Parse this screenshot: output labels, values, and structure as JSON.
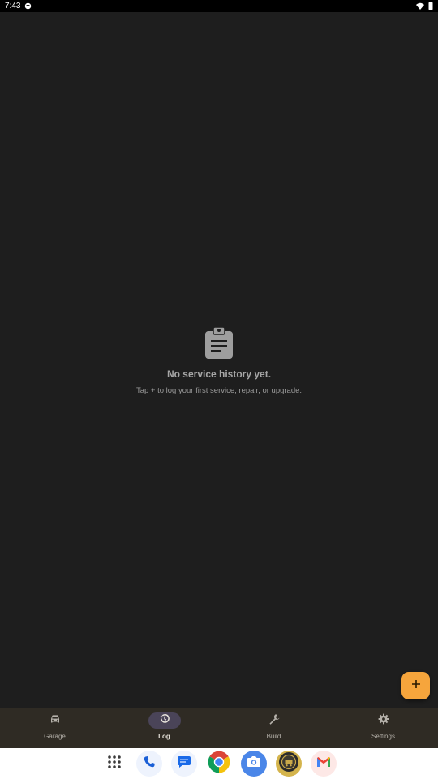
{
  "status_bar": {
    "time": "7:43"
  },
  "empty_state": {
    "title": "No service history yet.",
    "subtitle": "Tap + to log your first service, repair, or upgrade."
  },
  "fab": {
    "icon": "plus-icon"
  },
  "nav": {
    "items": [
      {
        "label": "Garage",
        "icon": "car-icon",
        "active": false
      },
      {
        "label": "Log",
        "icon": "history-icon",
        "active": true
      },
      {
        "label": "Build",
        "icon": "wrench-icon",
        "active": false
      },
      {
        "label": "Settings",
        "icon": "gear-icon",
        "active": false
      }
    ]
  },
  "dock": {
    "apps": [
      "app-drawer-icon",
      "phone-icon",
      "messages-icon",
      "chrome-icon",
      "camera-icon",
      "app-badge-icon",
      "gmail-icon"
    ]
  },
  "colors": {
    "background": "#1e1e1e",
    "nav_background": "#2f2b24",
    "fab": "#f6a53c",
    "active_indicator": "#4a4458"
  }
}
